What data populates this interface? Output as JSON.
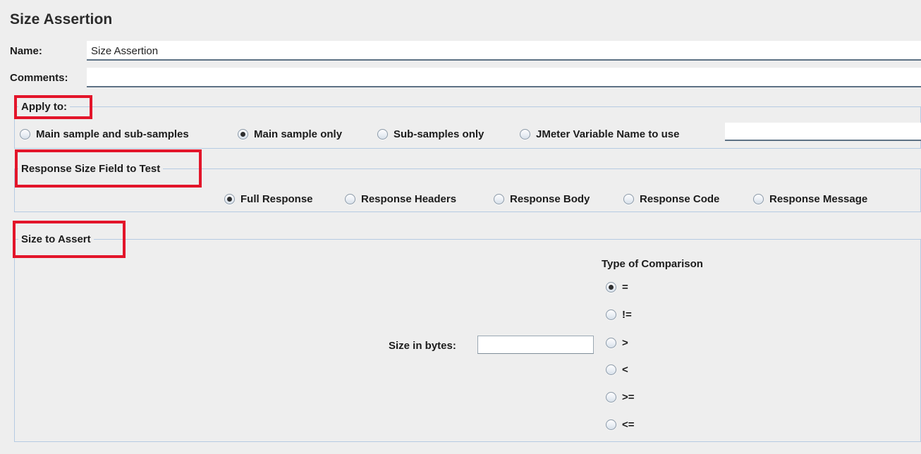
{
  "window": {
    "title": "Size Assertion",
    "background_color": "#eeeeee",
    "panel_border_color": "#b6cbe2",
    "highlight_color": "#e3152a"
  },
  "form": {
    "name": {
      "label": "Name:",
      "value": "Size Assertion",
      "placeholder": ""
    },
    "comments": {
      "label": "Comments:",
      "value": "",
      "placeholder": ""
    }
  },
  "apply_to": {
    "title": "Apply to:",
    "highlighted": true,
    "selected": "Main sample only",
    "options": [
      {
        "label": "Main sample and sub-samples",
        "selected": false
      },
      {
        "label": "Main sample only",
        "selected": true
      },
      {
        "label": "Sub-samples only",
        "selected": false
      },
      {
        "label": "JMeter Variable Name to use",
        "selected": false
      }
    ],
    "variable_field": {
      "value": "",
      "placeholder": ""
    }
  },
  "response_size_field": {
    "title": "Response Size Field to Test",
    "highlighted": true,
    "selected": "Full Response",
    "options": [
      {
        "label": "Full Response",
        "selected": true
      },
      {
        "label": "Response Headers",
        "selected": false
      },
      {
        "label": "Response Body",
        "selected": false
      },
      {
        "label": "Response Code",
        "selected": false
      },
      {
        "label": "Response Message",
        "selected": false
      }
    ]
  },
  "size_to_assert": {
    "title": "Size to Assert",
    "highlighted": true,
    "size_in_bytes": {
      "label": "Size in bytes:",
      "value": "",
      "placeholder": ""
    },
    "comparison": {
      "heading": "Type of Comparison",
      "selected": "=",
      "options": [
        {
          "label": "=",
          "selected": true
        },
        {
          "label": "!=",
          "selected": false
        },
        {
          "label": ">",
          "selected": false
        },
        {
          "label": "<",
          "selected": false
        },
        {
          "label": ">=",
          "selected": false
        },
        {
          "label": "<=",
          "selected": false
        }
      ]
    }
  }
}
